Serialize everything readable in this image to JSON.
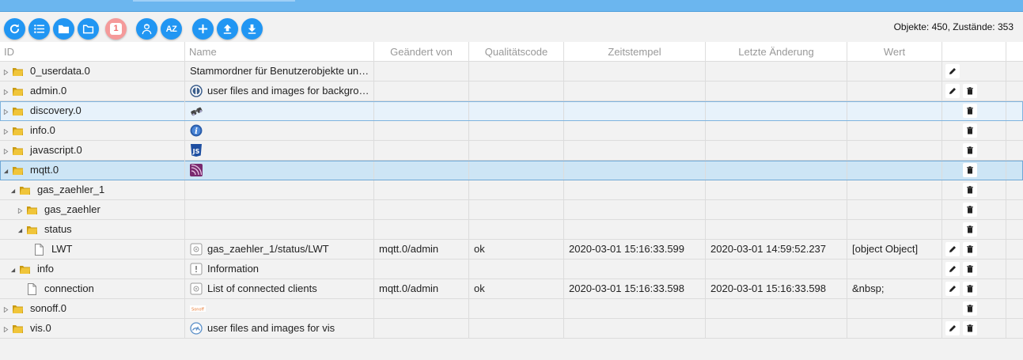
{
  "toolbar": {
    "buttons": [
      {
        "name": "refresh-button",
        "icon": "refresh-icon"
      },
      {
        "name": "list-view-button",
        "icon": "list-icon"
      },
      {
        "name": "folder-button",
        "icon": "folder-filled-icon"
      },
      {
        "name": "folder-outline-button",
        "icon": "folder-outline-icon"
      },
      {
        "name": "show-one-button",
        "icon": "calendar-one-icon",
        "badge": "1"
      },
      {
        "name": "expert-mode-button",
        "icon": "expert-icon"
      },
      {
        "name": "sort-az-button",
        "icon": "sort-az-icon",
        "text": "AZ"
      },
      {
        "name": "add-button",
        "icon": "plus-icon"
      },
      {
        "name": "upload-button",
        "icon": "upload-icon"
      },
      {
        "name": "download-button",
        "icon": "download-icon"
      }
    ],
    "counts": "Objekte: 450, Zustände: 353"
  },
  "headers": {
    "id": "ID",
    "name": "Name",
    "changed_by": "Geändert von",
    "quality": "Qualitätscode",
    "timestamp": "Zeitstempel",
    "last_change": "Letzte Änderung",
    "value": "Wert"
  },
  "rows": [
    {
      "id": "0_userdata.0",
      "name": "Stammordner für Benutzerobjekte un…",
      "changed_by": "",
      "quality": "",
      "timestamp": "",
      "last_change": "",
      "value": "",
      "icon": "",
      "level": 0,
      "type": "folder",
      "expanded": false,
      "edit": true,
      "delete": false
    },
    {
      "id": "admin.0",
      "name": "user files and images for backgro…",
      "changed_by": "",
      "quality": "",
      "timestamp": "",
      "last_change": "",
      "value": "",
      "icon": "admin-icon",
      "level": 0,
      "type": "folder",
      "expanded": false,
      "edit": true,
      "delete": true
    },
    {
      "id": "discovery.0",
      "name": "",
      "changed_by": "",
      "quality": "",
      "timestamp": "",
      "last_change": "",
      "value": "",
      "icon": "binoculars-icon",
      "level": 0,
      "type": "folder",
      "expanded": false,
      "edit": false,
      "delete": true,
      "state": "hover"
    },
    {
      "id": "info.0",
      "name": "",
      "changed_by": "",
      "quality": "",
      "timestamp": "",
      "last_change": "",
      "value": "",
      "icon": "info-adapter-icon",
      "level": 0,
      "type": "folder",
      "expanded": false,
      "edit": false,
      "delete": true
    },
    {
      "id": "javascript.0",
      "name": "",
      "changed_by": "",
      "quality": "",
      "timestamp": "",
      "last_change": "",
      "value": "",
      "icon": "javascript-icon",
      "level": 0,
      "type": "folder",
      "expanded": false,
      "edit": false,
      "delete": true
    },
    {
      "id": "mqtt.0",
      "name": "",
      "changed_by": "",
      "quality": "",
      "timestamp": "",
      "last_change": "",
      "value": "",
      "icon": "mqtt-icon",
      "level": 0,
      "type": "folder",
      "expanded": true,
      "edit": false,
      "delete": true,
      "state": "selected"
    },
    {
      "id": "gas_zaehler_1",
      "name": "",
      "changed_by": "",
      "quality": "",
      "timestamp": "",
      "last_change": "",
      "value": "",
      "icon": "",
      "level": 1,
      "type": "folder",
      "expanded": true,
      "edit": false,
      "delete": true
    },
    {
      "id": "gas_zaehler",
      "name": "",
      "changed_by": "",
      "quality": "",
      "timestamp": "",
      "last_change": "",
      "value": "",
      "icon": "",
      "level": 2,
      "type": "folder",
      "expanded": false,
      "edit": false,
      "delete": true
    },
    {
      "id": "status",
      "name": "",
      "changed_by": "",
      "quality": "",
      "timestamp": "",
      "last_change": "",
      "value": "",
      "icon": "",
      "level": 2,
      "type": "folder",
      "expanded": true,
      "edit": false,
      "delete": true
    },
    {
      "id": "LWT",
      "name": "gas_zaehler_1/status/LWT",
      "changed_by": "mqtt.0/admin",
      "quality": "ok",
      "timestamp": "2020-03-01 15:16:33.599",
      "last_change": "2020-03-01 14:59:52.237",
      "value": "[object Object]",
      "icon": "state-icon",
      "level": 3,
      "type": "file",
      "expanded": null,
      "edit": true,
      "delete": true
    },
    {
      "id": "info",
      "name": "Information",
      "changed_by": "",
      "quality": "",
      "timestamp": "",
      "last_change": "",
      "value": "",
      "icon": "channel-icon",
      "level": 1,
      "type": "folder",
      "expanded": true,
      "edit": true,
      "delete": true
    },
    {
      "id": "connection",
      "name": "List of connected clients",
      "changed_by": "mqtt.0/admin",
      "quality": "ok",
      "timestamp": "2020-03-01 15:16:33.598",
      "last_change": "2020-03-01 15:16:33.598",
      "value": "&nbsp;",
      "icon": "state-icon",
      "level": 2,
      "type": "file",
      "expanded": null,
      "edit": true,
      "delete": true
    },
    {
      "id": "sonoff.0",
      "name": "",
      "changed_by": "",
      "quality": "",
      "timestamp": "",
      "last_change": "",
      "value": "",
      "icon": "sonoff-icon",
      "level": 0,
      "type": "folder",
      "expanded": false,
      "edit": false,
      "delete": true
    },
    {
      "id": "vis.0",
      "name": "user files and images for vis",
      "changed_by": "",
      "quality": "",
      "timestamp": "",
      "last_change": "",
      "value": "",
      "icon": "vis-icon",
      "level": 0,
      "type": "folder",
      "expanded": false,
      "edit": true,
      "delete": true
    }
  ],
  "colors": {
    "accent": "#2196f3",
    "topbar": "#6bb6ef",
    "folder": "#e6b422",
    "selected_row": "#cde5f5",
    "hover_row": "#e7f2fb"
  }
}
